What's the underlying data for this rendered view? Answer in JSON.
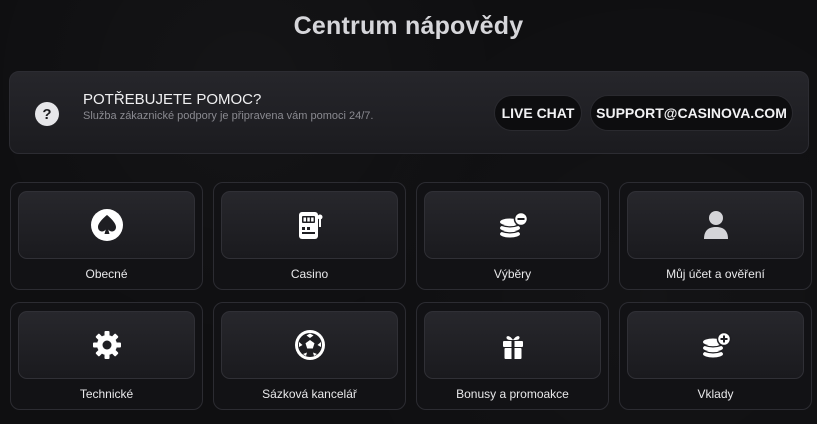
{
  "page": {
    "title": "Centrum nápovědy"
  },
  "help": {
    "icon": "question-icon",
    "icon_glyph": "?",
    "title": "POTŘEBUJETE POMOC?",
    "description": "Služba zákaznické podpory je připravena vám pomoci 24/7.",
    "live_chat_label": "LIVE CHAT",
    "email_label": "SUPPORT@CASINOVA.COM"
  },
  "categories": [
    {
      "label": "Obecné",
      "icon": "spade-icon"
    },
    {
      "label": "Casino",
      "icon": "slot-machine-icon"
    },
    {
      "label": "Výběry",
      "icon": "coins-minus-icon"
    },
    {
      "label": "Můj účet a ověření",
      "icon": "user-icon"
    },
    {
      "label": "Technické",
      "icon": "gear-icon"
    },
    {
      "label": "Sázková kancelář",
      "icon": "soccer-ball-icon"
    },
    {
      "label": "Bonusy a promoakce",
      "icon": "gift-icon"
    },
    {
      "label": "Vklady",
      "icon": "coins-plus-icon"
    }
  ],
  "colors": {
    "background": "#0f0f11",
    "card": "#121215",
    "text_muted": "#8a8a90"
  }
}
